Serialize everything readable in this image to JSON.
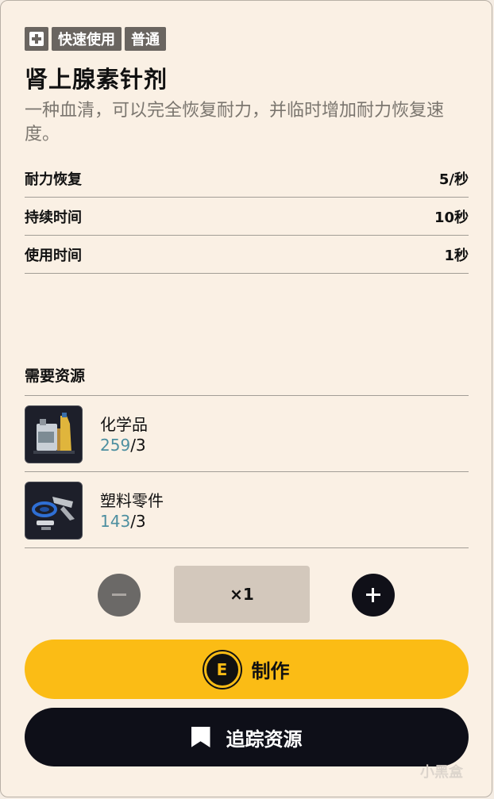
{
  "tags": {
    "category": "快速使用",
    "rarity": "普通"
  },
  "item": {
    "name": "肾上腺素针剂",
    "description": "一种血清，可以完全恢复耐力，并临时增加耐力恢复速度。"
  },
  "stats": [
    {
      "label": "耐力恢复",
      "value": "5/秒"
    },
    {
      "label": "持续时间",
      "value": "10秒"
    },
    {
      "label": "使用时间",
      "value": "1秒"
    }
  ],
  "resources": {
    "header": "需要资源",
    "items": [
      {
        "name": "化学品",
        "have": "259",
        "need": "/3",
        "icon": "chemicals-icon"
      },
      {
        "name": "塑料零件",
        "have": "143",
        "need": "/3",
        "icon": "plastic-parts-icon"
      }
    ]
  },
  "quantity": {
    "value": "×1"
  },
  "actions": {
    "craft_key": "E",
    "craft_label": "制作",
    "track_label": "追踪资源"
  },
  "watermark": "小黑盒",
  "colors": {
    "accent": "#fbbc15",
    "dark": "#0e0f18",
    "count_highlight": "#4d8fa0",
    "background": "#faf0e4"
  }
}
